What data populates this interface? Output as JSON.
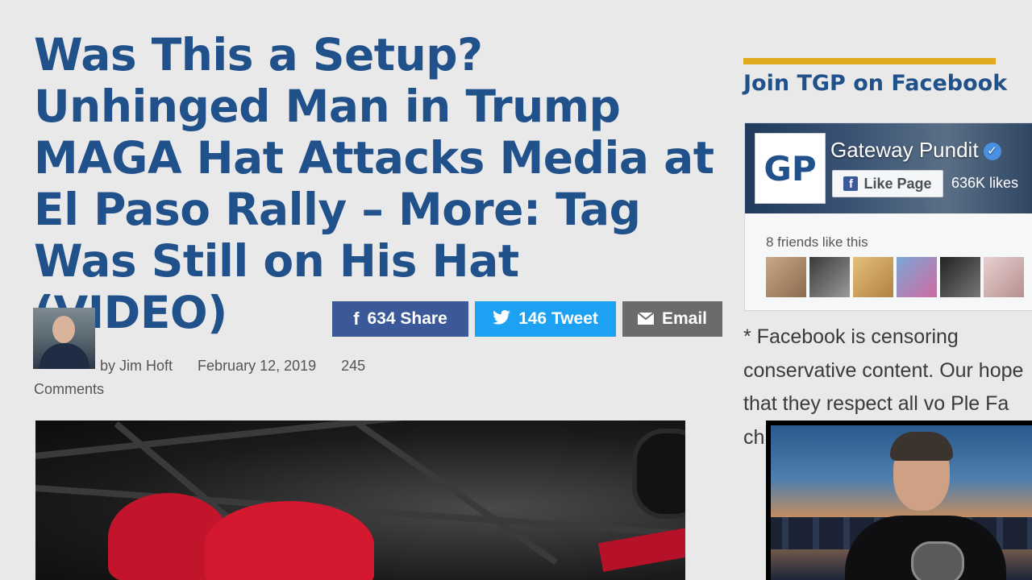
{
  "article": {
    "headline": "Was This a Setup? Unhinged Man in Trump MAGA Hat Attacks Media at El Paso Rally – More: Tag Was Still on His Hat (VIDEO)",
    "byline": "by Jim Hoft",
    "date": "February 12, 2019",
    "comments_count": "245",
    "comments_label": "Comments"
  },
  "share": {
    "facebook": {
      "count": "634",
      "label": "Share",
      "icon": "f"
    },
    "twitter": {
      "count": "146",
      "label": "Tweet",
      "icon": "bird"
    },
    "email": {
      "label": "Email",
      "icon": "envelope"
    }
  },
  "sidebar": {
    "title": "Join TGP on Facebook",
    "fb_widget": {
      "logo": "GP",
      "page_name": "Gateway Pundit",
      "like_button": "Like Page",
      "likes": "636K likes",
      "friends_text": "8 friends like this"
    },
    "notice": "* Facebook is censoring conservative content. Our hope that they respect all vo Ple Fa ch ho"
  },
  "colors": {
    "headline": "#21518a",
    "accent": "#e0a81e",
    "facebook": "#3b5998",
    "twitter": "#1da1f2",
    "email": "#6b6b6b"
  }
}
